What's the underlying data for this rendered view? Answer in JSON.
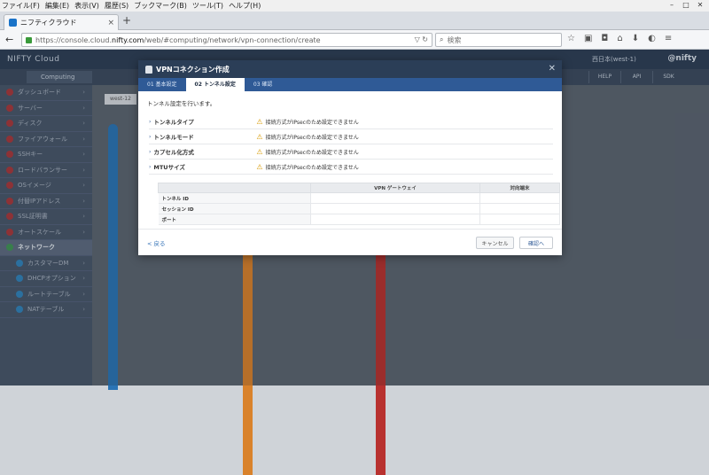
{
  "menubar": [
    "ファイル(F)",
    "編集(E)",
    "表示(V)",
    "履歴(S)",
    "ブックマーク(B)",
    "ツール(T)",
    "ヘルプ(H)"
  ],
  "window_controls": [
    "–",
    "□",
    "✕"
  ],
  "browser": {
    "tab_title": "ニフティクラウド",
    "tab_close": "×",
    "new_tab": "+",
    "url_prefix": "https://console.cloud.",
    "url_host": "nifty.com",
    "url_suffix": "/web/#computing/network/vpn-connection/create",
    "url_actions": "▽ ↻",
    "search_placeholder": "検索",
    "search_icon": "⌕"
  },
  "app": {
    "logo": "NIFTY Cloud",
    "logo_right": "@nifty",
    "region": "西日本(west-1)",
    "computing_tab": "Computing",
    "header_buttons": [
      "HELP",
      "API",
      "SDK"
    ],
    "west_tag": "west-12"
  },
  "sidebar": {
    "items": [
      {
        "label": "ダッシュボード"
      },
      {
        "label": "サーバー"
      },
      {
        "label": "ディスク"
      },
      {
        "label": "ファイアウォール"
      },
      {
        "label": "SSHキー"
      },
      {
        "label": "ロードバランサー"
      },
      {
        "label": "OSイメージ"
      },
      {
        "label": "付替IPアドレス"
      },
      {
        "label": "SSL証明書"
      },
      {
        "label": "オートスケール"
      },
      {
        "label": "ネットワーク"
      },
      {
        "label": "カスタマーDM"
      },
      {
        "label": "DHCPオプション"
      },
      {
        "label": "ルートテーブル"
      },
      {
        "label": "NATテーブル"
      }
    ]
  },
  "modal": {
    "title": "VPNコネクション作成",
    "close": "✕",
    "tabs": [
      "01 基本設定",
      "02 トンネル設定",
      "03 確認"
    ],
    "intro": "トンネル設定を行います。",
    "fields": [
      {
        "label": "トンネルタイプ",
        "value": "接続方式がIPsecのため設定できません"
      },
      {
        "label": "トンネルモード",
        "value": "接続方式がIPsecのため設定できません"
      },
      {
        "label": "カプセル化方式",
        "value": "接続方式がIPsecのため設定できません"
      },
      {
        "label": "MTUサイズ",
        "value": "接続方式がIPsecのため設定できません"
      }
    ],
    "table": {
      "headers": [
        "",
        "VPN ゲートウェイ",
        "対向端末"
      ],
      "rows": [
        "トンネル ID",
        "セッション ID",
        "ポート"
      ]
    },
    "back": "< 戻る",
    "cancel": "キャンセル",
    "confirm": "確認へ"
  },
  "colors": {
    "header_dark": "#2b3e57",
    "tab_blue": "#2f5a96",
    "warning": "#d89a00",
    "bar_blue": "#2a74b5",
    "bar_orange": "#d9822b",
    "bar_red": "#b8312f"
  }
}
